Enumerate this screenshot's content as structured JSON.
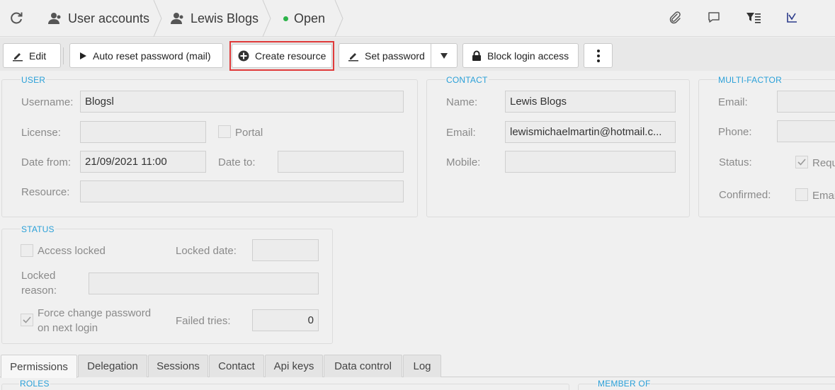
{
  "breadcrumb": {
    "user_accounts": "User accounts",
    "user_name": "Lewis Blogs",
    "status": "Open",
    "status_color": "#2db34a"
  },
  "toolbar": {
    "edit": "Edit",
    "auto_reset": "Auto reset password (mail)",
    "create_resource": "Create resource",
    "set_password": "Set password",
    "block_login": "Block login access"
  },
  "user_panel": {
    "title": "USER",
    "username_label": "Username:",
    "username_value": "Blogsl",
    "license_label": "License:",
    "license_value": "",
    "portal_label": "Portal",
    "date_from_label": "Date from:",
    "date_from_value": "21/09/2021 11:00",
    "date_to_label": "Date to:",
    "date_to_value": "",
    "resource_label": "Resource:",
    "resource_value": ""
  },
  "contact_panel": {
    "title": "CONTACT",
    "name_label": "Name:",
    "name_value": "Lewis Blogs",
    "email_label": "Email:",
    "email_value": "lewismichaelmartin@hotmail.c...",
    "mobile_label": "Mobile:",
    "mobile_value": ""
  },
  "mfa_panel": {
    "title": "MULTI-FACTOR",
    "email_label": "Email:",
    "phone_label": "Phone:",
    "status_label": "Status:",
    "status_check_label": "Requ",
    "confirmed_label": "Confirmed:",
    "confirmed_check_label": "Emai"
  },
  "status_panel": {
    "title": "STATUS",
    "access_locked_label": "Access locked",
    "locked_date_label": "Locked date:",
    "locked_date_value": "",
    "locked_reason_label_1": "Locked",
    "locked_reason_label_2": "reason:",
    "locked_reason_value": "",
    "force_change_label_1": "Force change password",
    "force_change_label_2": "on next login",
    "failed_tries_label": "Failed tries:",
    "failed_tries_value": "0"
  },
  "tabs": [
    "Permissions",
    "Delegation",
    "Sessions",
    "Contact",
    "Api keys",
    "Data control",
    "Log"
  ],
  "bottom": {
    "roles_title": "ROLES",
    "member_of_title": "MEMBER OF"
  }
}
